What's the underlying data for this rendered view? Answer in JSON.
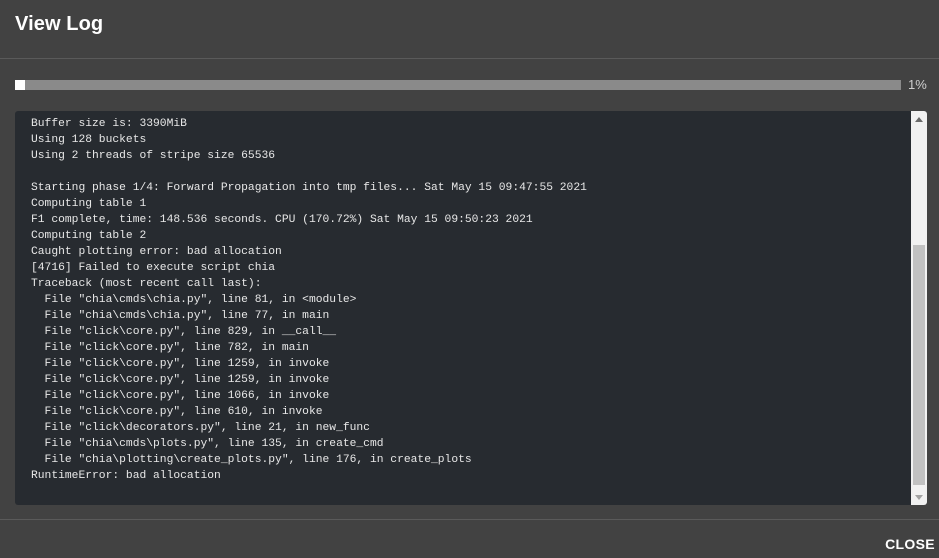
{
  "dialog": {
    "title": "View Log",
    "close_label": "CLOSE"
  },
  "progress": {
    "value_percent": 1,
    "label": "1%"
  },
  "log": {
    "lines": [
      "Buffer size is: 3390MiB",
      "Using 128 buckets",
      "Using 2 threads of stripe size 65536",
      "",
      "Starting phase 1/4: Forward Propagation into tmp files... Sat May 15 09:47:55 2021",
      "Computing table 1",
      "F1 complete, time: 148.536 seconds. CPU (170.72%) Sat May 15 09:50:23 2021",
      "Computing table 2",
      "Caught plotting error: bad allocation",
      "[4716] Failed to execute script chia",
      "Traceback (most recent call last):",
      "  File \"chia\\cmds\\chia.py\", line 81, in <module>",
      "  File \"chia\\cmds\\chia.py\", line 77, in main",
      "  File \"click\\core.py\", line 829, in __call__",
      "  File \"click\\core.py\", line 782, in main",
      "  File \"click\\core.py\", line 1259, in invoke",
      "  File \"click\\core.py\", line 1259, in invoke",
      "  File \"click\\core.py\", line 1066, in invoke",
      "  File \"click\\core.py\", line 610, in invoke",
      "  File \"click\\decorators.py\", line 21, in new_func",
      "  File \"chia\\cmds\\plots.py\", line 135, in create_cmd",
      "  File \"chia\\plotting\\create_plots.py\", line 176, in create_plots",
      "RuntimeError: bad allocation"
    ]
  },
  "colors": {
    "dialog_background": "#424242",
    "log_background": "#272b30",
    "progress_track": "#8a8a8a",
    "progress_fill": "#ffffff"
  }
}
